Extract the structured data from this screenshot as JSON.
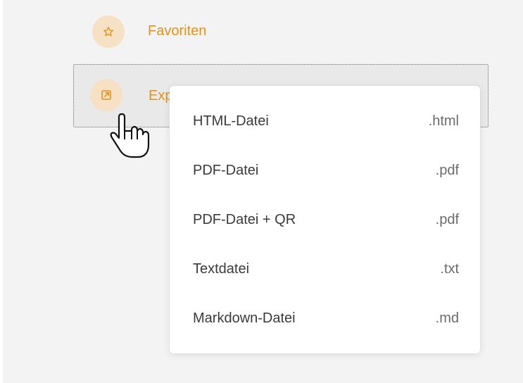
{
  "nav": {
    "favorites": {
      "label": "Favoriten",
      "icon": "star-icon"
    },
    "export": {
      "label": "Exportieren",
      "icon": "external-link-icon"
    }
  },
  "menu": {
    "items": [
      {
        "label": "HTML-Datei",
        "ext": ".html"
      },
      {
        "label": "PDF-Datei",
        "ext": ".pdf"
      },
      {
        "label": "PDF-Datei + QR",
        "ext": ".pdf"
      },
      {
        "label": "Textdatei",
        "ext": ".txt"
      },
      {
        "label": "Markdown-Datei",
        "ext": ".md"
      }
    ]
  },
  "colors": {
    "accent": "#e0921a",
    "icon_circle": "#f6e1c4",
    "background": "#f3f3f3",
    "hover": "#e9e9e9"
  }
}
